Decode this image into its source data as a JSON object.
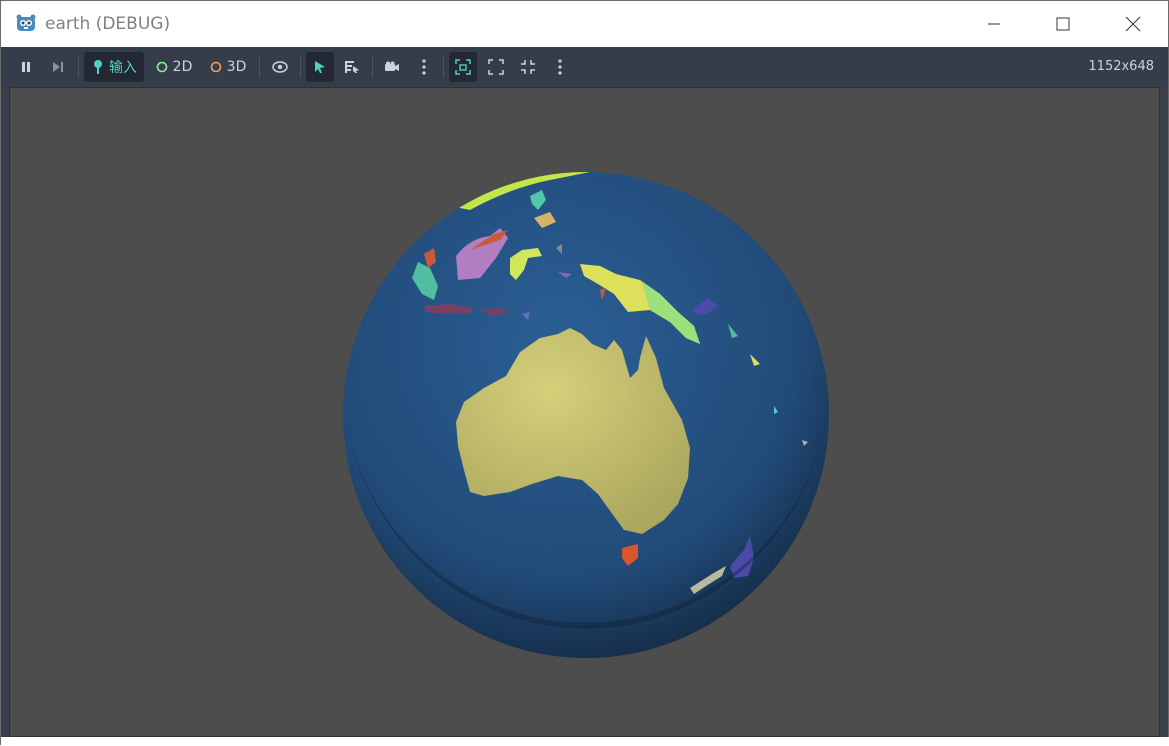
{
  "window": {
    "title": "earth (DEBUG)",
    "icon": "godot-icon",
    "controls": [
      "minimize-icon",
      "maximize-icon",
      "close-icon"
    ]
  },
  "toolbar": {
    "pause_icon": "pause-icon",
    "next_frame_icon": "next-frame-icon",
    "input_label": "输入",
    "mode_2d_label": "2D",
    "mode_3d_label": "3D",
    "resolution": "1152x648"
  },
  "colors": {
    "toolbar_bg": "#363d4a",
    "viewport_bg": "#4d4d4d",
    "accent": "#4fd1c5",
    "ocean": "#234f80",
    "australia": "#c8c36e"
  }
}
